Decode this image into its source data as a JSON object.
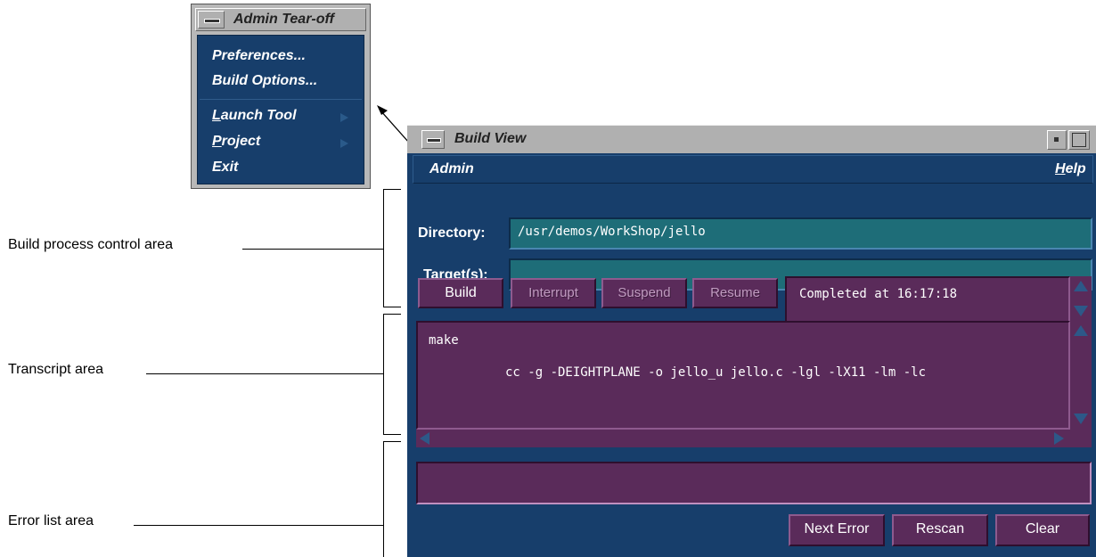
{
  "annotations": {
    "build_control": "Build process control area",
    "transcript": "Transcript area",
    "error_list": "Error list area"
  },
  "tearoff": {
    "title": "Admin Tear-off",
    "items": [
      {
        "label": "Preferences..."
      },
      {
        "label": "Build Options..."
      },
      {
        "label_u": "L",
        "label_rest": "aunch Tool",
        "submenu": true
      },
      {
        "label_u": "P",
        "label_rest": "roject",
        "submenu": true
      },
      {
        "label": "Exit"
      }
    ]
  },
  "window": {
    "title": "Build View",
    "menu": {
      "admin": "Admin",
      "help_u": "H",
      "help_rest": "elp"
    }
  },
  "form": {
    "directory_label": "Directory:",
    "directory_value": "/usr/demos/WorkShop/jello",
    "targets_label": "Target(s):",
    "targets_value": ""
  },
  "buttons": {
    "build": "Build",
    "interrupt": "Interrupt",
    "suspend": "Suspend",
    "resume": "Resume",
    "next_error": "Next Error",
    "rescan": "Rescan",
    "clear": "Clear"
  },
  "status": {
    "text": "Completed at 16:17:18"
  },
  "transcript": {
    "lines": [
      "make",
      "cc -g -DEIGHTPLANE -o jello_u jello.c -lgl -lX11 -lm -lc"
    ]
  },
  "colors": {
    "window_bg": "#173e6b",
    "field_bg": "#1e6d78",
    "button_bg": "#5a2b5a",
    "title_bar": "#b0b0b0"
  }
}
